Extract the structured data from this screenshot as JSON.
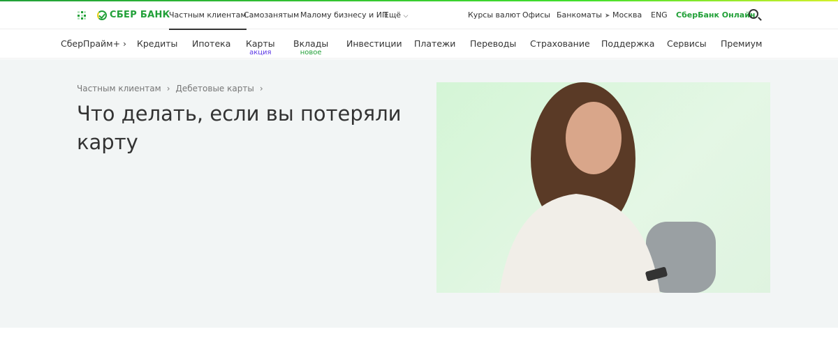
{
  "header": {
    "logo": "СБЕР БАНК",
    "segments": [
      "Частным клиентам",
      "Самозанятым",
      "Малому бизнесу и ИП",
      "Ещё"
    ],
    "links": [
      "Курсы валют",
      "Офисы",
      "Банкоматы"
    ],
    "city": "Москва",
    "lang": "ENG",
    "online": "СберБанк Онлайн"
  },
  "nav": {
    "items": [
      {
        "label": "СберПрайм+ ›"
      },
      {
        "label": "Кредиты"
      },
      {
        "label": "Ипотека"
      },
      {
        "label": "Карты",
        "badge": "акция"
      },
      {
        "label": "Вклады",
        "badge": "новое"
      },
      {
        "label": "Инвестиции"
      },
      {
        "label": "Платежи"
      },
      {
        "label": "Переводы"
      },
      {
        "label": "Страхование"
      },
      {
        "label": "Поддержка"
      },
      {
        "label": "Сервисы"
      },
      {
        "label": "Премиум"
      }
    ]
  },
  "breadcrumbs": [
    "Частным клиентам",
    "Дебетовые карты"
  ],
  "page": {
    "title": "Что делать, если вы потеряли карту"
  },
  "colors": {
    "brand": "#21a038",
    "promo": "#5c37e6"
  }
}
